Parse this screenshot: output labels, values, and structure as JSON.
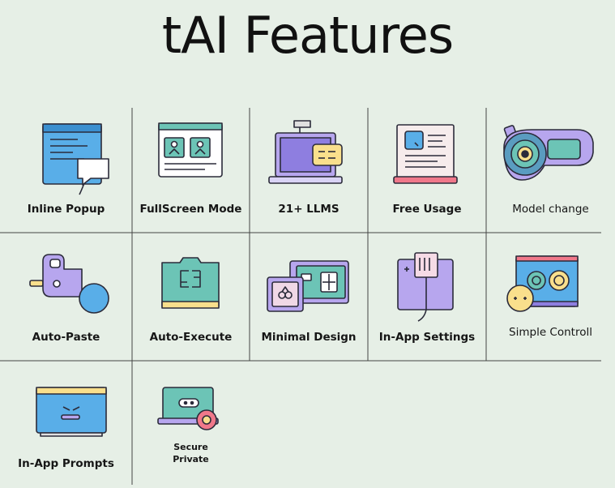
{
  "title": "tAI Features",
  "features": [
    {
      "label": "Inline Popup",
      "icon": "popup-window-icon"
    },
    {
      "label": "FullScreen Mode",
      "icon": "fullscreen-window-icon"
    },
    {
      "label": "21+ LLMS",
      "icon": "laptop-chat-icon"
    },
    {
      "label": "Free Usage",
      "icon": "document-icon"
    },
    {
      "label": "Model change",
      "icon": "camera-model-icon"
    },
    {
      "label": "Auto-Paste",
      "icon": "paste-plug-icon"
    },
    {
      "label": "Auto-Execute",
      "icon": "execute-window-icon"
    },
    {
      "label": "Minimal Design",
      "icon": "minimal-cards-icon"
    },
    {
      "label": "In-App Settings",
      "icon": "settings-panel-icon"
    },
    {
      "label": "Simple Controll",
      "icon": "control-dials-icon"
    },
    {
      "label": "In-App Prompts",
      "icon": "prompt-window-icon"
    },
    {
      "label_line1": "Secure",
      "label_line2": "Private",
      "icon": "secure-laptop-icon"
    }
  ],
  "colors": {
    "background": "#e6efe6",
    "blue": "#59aee8",
    "purple": "#b7a6ee",
    "teal": "#6cc4b6",
    "yellow": "#f9df8c",
    "pink": "#f0788a",
    "outline": "#2b2b3a"
  }
}
